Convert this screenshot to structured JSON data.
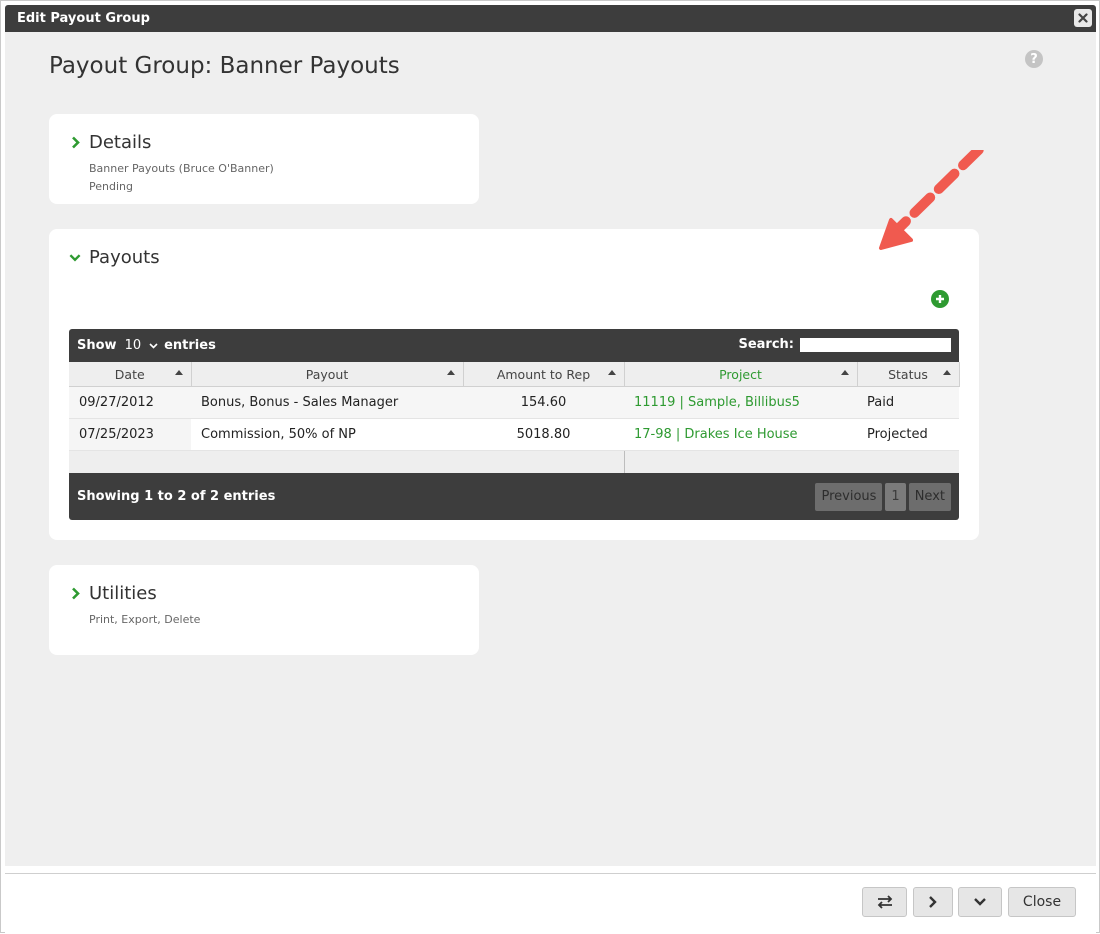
{
  "window": {
    "title": "Edit Payout Group"
  },
  "page": {
    "title": "Payout Group: Banner Payouts"
  },
  "details": {
    "title": "Details",
    "lines": [
      "Banner Payouts (Bruce O'Banner)",
      "Pending"
    ]
  },
  "payouts": {
    "title": "Payouts",
    "table": {
      "length": {
        "show": "Show",
        "value": "10",
        "entries": "entries"
      },
      "search_label": "Search:",
      "search_value": "",
      "columns": [
        "Date",
        "Payout",
        "Amount to Rep",
        "Project",
        "Status"
      ],
      "rows": [
        {
          "date": "09/27/2012",
          "payout": "Bonus, Bonus - Sales Manager",
          "amount": "154.60",
          "project": "11119 | Sample, Billibus5",
          "status": "Paid"
        },
        {
          "date": "07/25/2023",
          "payout": "Commission, 50% of NP",
          "amount": "5018.80",
          "project": "17-98 | Drakes Ice House",
          "status": "Projected"
        }
      ],
      "info": "Showing 1 to 2 of 2 entries",
      "pagination": {
        "previous": "Previous",
        "page": "1",
        "next": "Next"
      }
    }
  },
  "utilities": {
    "title": "Utilities",
    "subtitle": "Print, Export, Delete"
  },
  "footer": {
    "close_label": "Close"
  },
  "colors": {
    "accent": "#2e9a31",
    "dark": "#3d3d3d",
    "arrow": "#f05a4f"
  }
}
